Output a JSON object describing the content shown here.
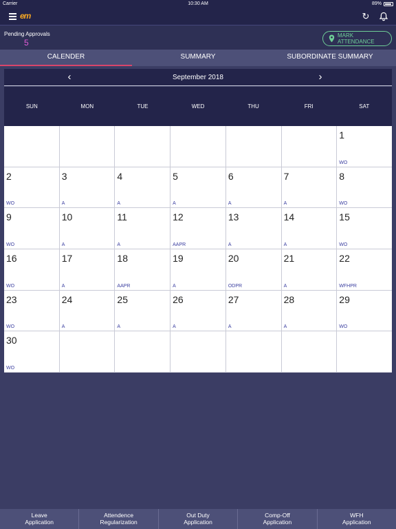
{
  "status_bar": {
    "carrier": "Carrier",
    "time": "10:30 AM",
    "battery": "89%"
  },
  "app": {
    "logo": "em",
    "icons": {
      "menu": "hamburger-icon",
      "refresh": "refresh-icon",
      "notifications": "bell-icon"
    }
  },
  "pending": {
    "label": "Pending Approvals",
    "count": "5"
  },
  "mark_attendance": {
    "label": "MARK ATTENDANCE",
    "icon": "location-pin-icon"
  },
  "tabs": [
    {
      "label": "CALENDER",
      "active": true
    },
    {
      "label": "SUMMARY",
      "active": false
    },
    {
      "label": "SUBORDINATE SUMMARY",
      "active": false
    }
  ],
  "calendar": {
    "month_title": "September 2018",
    "prev_arrow": "‹",
    "next_arrow": "›",
    "weekdays": [
      "SUN",
      "MON",
      "TUE",
      "WED",
      "THU",
      "FRI",
      "SAT"
    ],
    "days": [
      {
        "day": "",
        "status": ""
      },
      {
        "day": "",
        "status": ""
      },
      {
        "day": "",
        "status": ""
      },
      {
        "day": "",
        "status": ""
      },
      {
        "day": "",
        "status": ""
      },
      {
        "day": "",
        "status": ""
      },
      {
        "day": "1",
        "status": "WO"
      },
      {
        "day": "2",
        "status": "WO"
      },
      {
        "day": "3",
        "status": "A"
      },
      {
        "day": "4",
        "status": "A"
      },
      {
        "day": "5",
        "status": "A"
      },
      {
        "day": "6",
        "status": "A"
      },
      {
        "day": "7",
        "status": "A"
      },
      {
        "day": "8",
        "status": "WO"
      },
      {
        "day": "9",
        "status": "WO"
      },
      {
        "day": "10",
        "status": "A"
      },
      {
        "day": "11",
        "status": "A"
      },
      {
        "day": "12",
        "status": "AAPR"
      },
      {
        "day": "13",
        "status": "A"
      },
      {
        "day": "14",
        "status": "A"
      },
      {
        "day": "15",
        "status": "WO"
      },
      {
        "day": "16",
        "status": "WO"
      },
      {
        "day": "17",
        "status": "A"
      },
      {
        "day": "18",
        "status": "AAPR"
      },
      {
        "day": "19",
        "status": "A"
      },
      {
        "day": "20",
        "status": "ODPR"
      },
      {
        "day": "21",
        "status": "A"
      },
      {
        "day": "22",
        "status": "WFHPR"
      },
      {
        "day": "23",
        "status": "WO"
      },
      {
        "day": "24",
        "status": "A"
      },
      {
        "day": "25",
        "status": "A"
      },
      {
        "day": "26",
        "status": "A"
      },
      {
        "day": "27",
        "status": "A"
      },
      {
        "day": "28",
        "status": "A"
      },
      {
        "day": "29",
        "status": "WO"
      },
      {
        "day": "30",
        "status": "WO"
      },
      {
        "day": "",
        "status": ""
      },
      {
        "day": "",
        "status": ""
      },
      {
        "day": "",
        "status": ""
      },
      {
        "day": "",
        "status": ""
      },
      {
        "day": "",
        "status": ""
      },
      {
        "day": "",
        "status": ""
      }
    ]
  },
  "bottom_bar": [
    {
      "line1": "Leave",
      "line2": "Application"
    },
    {
      "line1": "Attendence",
      "line2": "Regularization"
    },
    {
      "line1": "Out Duty",
      "line2": "Application"
    },
    {
      "line1": "Comp-Off",
      "line2": "Application"
    },
    {
      "line1": "WFH",
      "line2": "Application"
    }
  ],
  "colors": {
    "header_bg": "#23244a",
    "page_bg": "#3b3d64",
    "accent_green": "#6fcf97",
    "accent_pink": "#d9456a",
    "pending_count": "#e05bd6",
    "status_text": "#3b3fa0"
  }
}
